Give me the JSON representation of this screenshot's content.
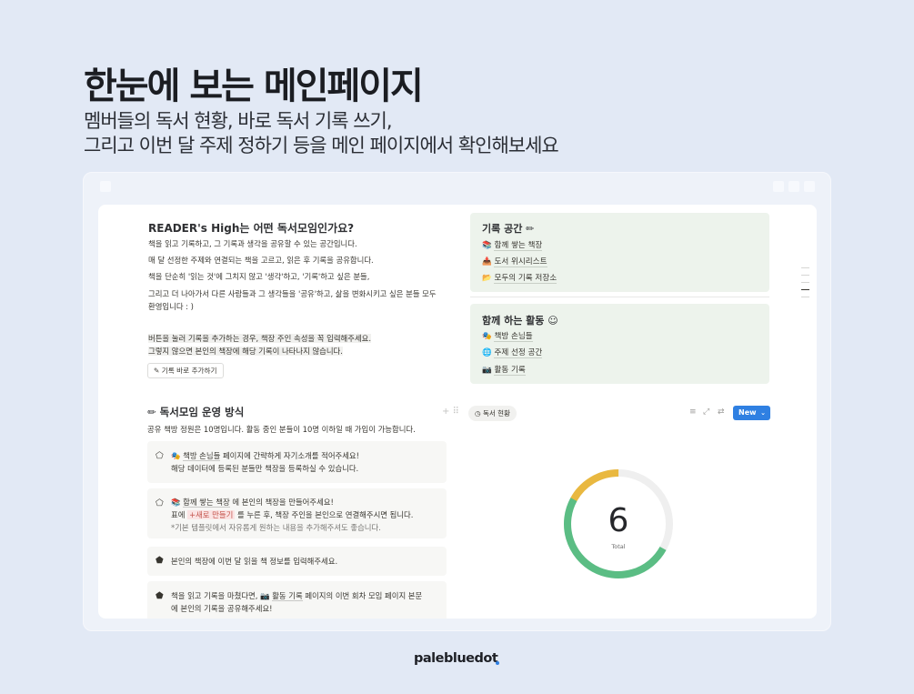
{
  "hero": {
    "title": "한눈에 보는 메인페이지",
    "subtitle_line1": "멤버들의 독서 현황, 바로 독서 기록 쓰기,",
    "subtitle_line2": "그리고 이번 달 주제 정하기 등을 메인 페이지에서 확인해보세요"
  },
  "intro": {
    "title": "READER's High는 어떤 독서모임인가요?",
    "p1": "책을 읽고 기록하고, 그 기록과 생각을 공유할 수 있는 공간입니다.",
    "p2": "매 달 선정한 주제와 연결되는 책을 고르고, 읽은 후 기록을 공유합니다.",
    "p3": "책을 단순히 '읽는 것'에 그치지 않고 '생각'하고, '기록'하고 싶은 분들,",
    "p4a": "그리고 더 나아가서 다른 사람들과 그 생각들을 '공유'하고, 삶을 변화시키고 싶은 분들 모두",
    "p4b": "환영입니다 : )",
    "note1": "버튼을 눌러 기록을 추가하는 경우, 책장 주인 속성을 꼭 입력해주세요.",
    "note2": "그렇지 않으면 본인의 책장에 해당 기록이 나타나지 않습니다.",
    "add_button": "기록 바로 추가하기"
  },
  "record_space": {
    "title": "기록 공간",
    "items": [
      {
        "emoji": "📚",
        "label": "함께 쌓는 책장"
      },
      {
        "emoji": "📥",
        "label": "도서 위시리스트"
      },
      {
        "emoji": "📂",
        "label": "모두의 기록 저장소"
      }
    ]
  },
  "activities": {
    "title": "함께 하는 활동",
    "items": [
      {
        "emoji": "🎭",
        "label": "책방 손님들"
      },
      {
        "emoji": "🌐",
        "label": "주제 선정 공간"
      },
      {
        "emoji": "📷",
        "label": "활동 기록"
      }
    ]
  },
  "ops": {
    "title": "독서모임 운영 방식",
    "desc": "공유 책방 정원은 10명입니다. 활동 중인 분들이 10명 이하일 때 가입이 가능합니다.",
    "step1": {
      "line1_ref": "책방 손님들",
      "line1_rest": " 페이지에 간략하게 자기소개를 적어주세요!",
      "line2": "해당 데이터에 등록된 분들만 책장을 등록하실 수 있습니다."
    },
    "step2": {
      "line1_ref": "함께 쌓는 책장",
      "line1_rest": "  에 본인의 책장을 만들어주세요!",
      "line2_pre": "표에 ",
      "line2_tag": "+새로 만들기",
      "line2_post": " 를 누른 후, 책장 주인을 본인으로 연결해주시면 됩니다.",
      "line3": "*기본 템플릿에서 자유롭게 원하는 내용을 추가해주셔도 좋습니다."
    },
    "step3": {
      "line1": "본인의 책장에 이번 달 읽을 책 정보를 입력해주세요."
    },
    "step4": {
      "line1_pre": "책을 읽고 기록을 마쳤다면, ",
      "line1_ref": "활동 기록",
      "line1_post": " 페이지의 이번 회차 모임 페이지 본문",
      "line2": "에 본인의 기록을 공유해주세요!"
    }
  },
  "view": {
    "tab_label": "독서 현황",
    "new_button": "New",
    "total_value": "6",
    "total_label": "Total"
  },
  "chart_data": {
    "type": "pie",
    "total": 6,
    "slices_fraction": [
      0.17,
      0.5
    ],
    "colors": {
      "green": "#5bbd84",
      "yellow": "#e9b840",
      "track": "#efefef"
    }
  },
  "brand": {
    "name": "palebluedot"
  }
}
